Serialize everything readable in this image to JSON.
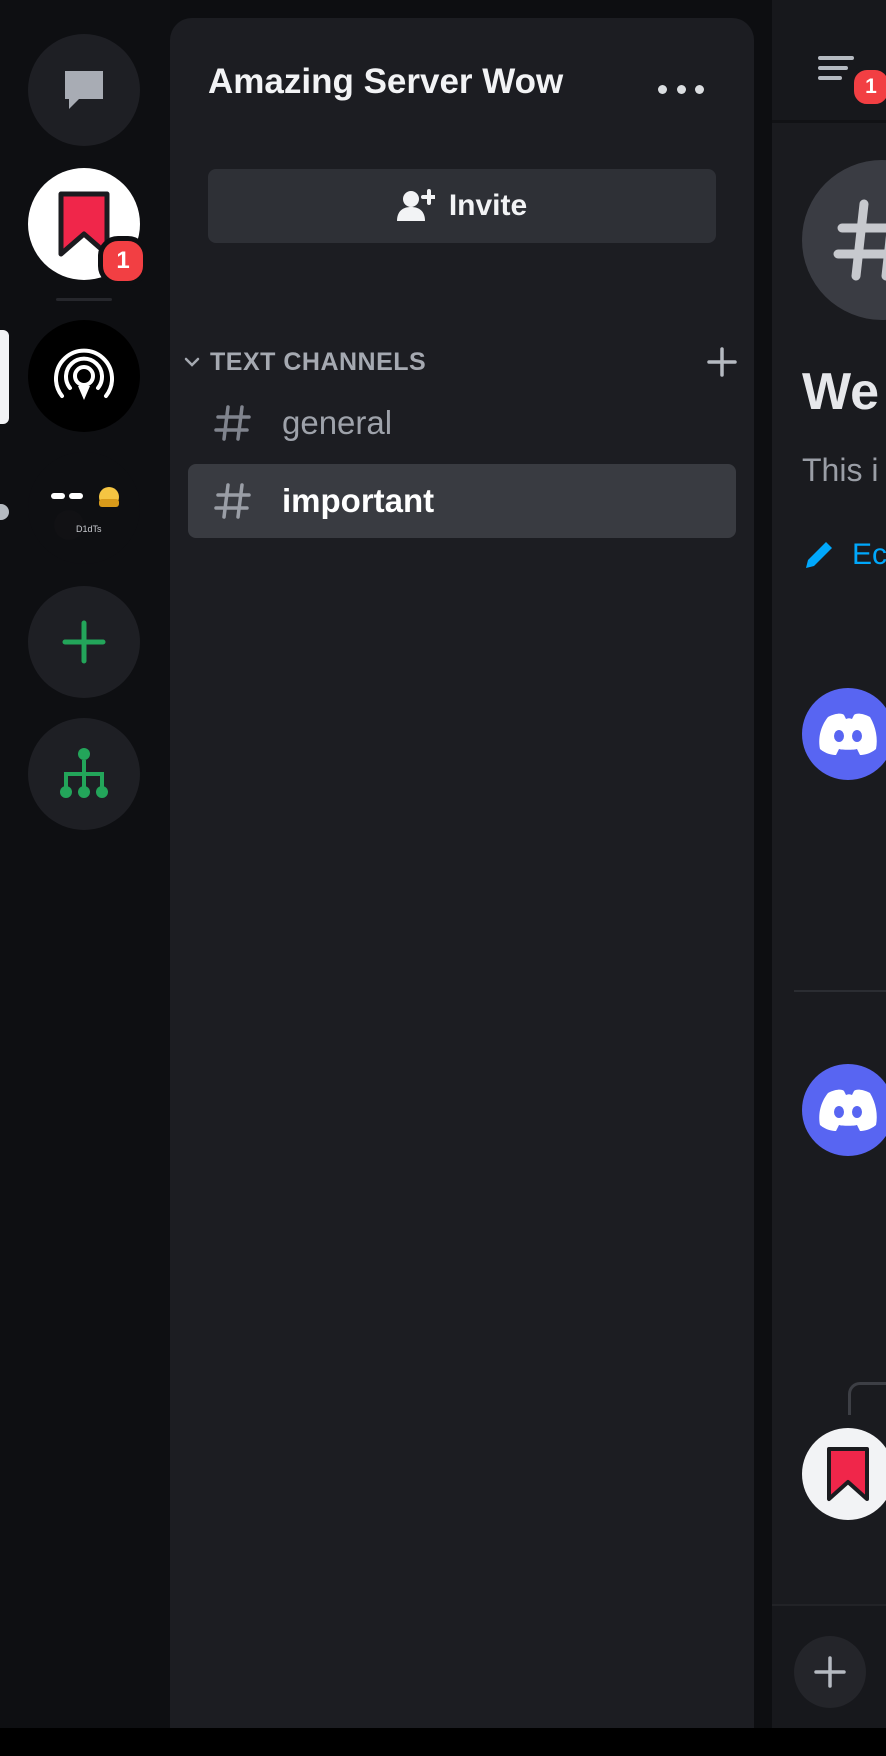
{
  "server": {
    "name": "Amazing Server Wow",
    "invite_label": "Invite"
  },
  "rail": {
    "dm_icon": "chat-bubble-icon",
    "active_server_icon": "bookmark-icon",
    "active_server_badge": "1",
    "add_server_icon": "plus-icon",
    "discover_icon": "hub-tree-icon",
    "mini_server_text": "D1dTs"
  },
  "category": {
    "label": "TEXT CHANNELS"
  },
  "channels": [
    {
      "name": "general",
      "selected": false
    },
    {
      "name": "important",
      "selected": true
    }
  ],
  "main": {
    "header_badge": "1",
    "welcome_title": "We",
    "welcome_desc": "This i",
    "edit_label": "Ec"
  },
  "colors": {
    "accent_red": "#f23f43",
    "blurple": "#5865f2",
    "green": "#23a55a",
    "link_blue": "#00a8fc"
  }
}
